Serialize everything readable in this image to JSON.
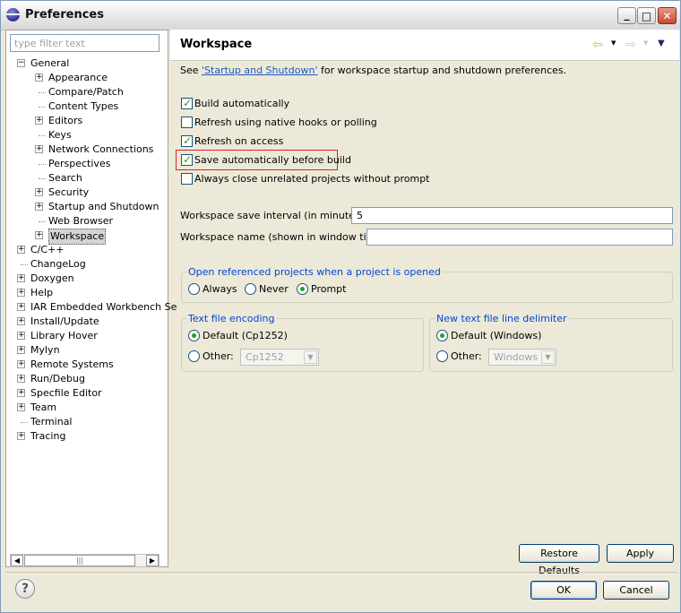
{
  "window": {
    "title": "Preferences"
  },
  "sidebar": {
    "filter_placeholder": "type filter text",
    "tree": [
      {
        "label": "General",
        "level": 0,
        "expander": "minus"
      },
      {
        "label": "Appearance",
        "level": 1,
        "expander": "plus"
      },
      {
        "label": "Compare/Patch",
        "level": 1,
        "expander": "none"
      },
      {
        "label": "Content Types",
        "level": 1,
        "expander": "none"
      },
      {
        "label": "Editors",
        "level": 1,
        "expander": "plus"
      },
      {
        "label": "Keys",
        "level": 1,
        "expander": "none"
      },
      {
        "label": "Network Connections",
        "level": 1,
        "expander": "plus"
      },
      {
        "label": "Perspectives",
        "level": 1,
        "expander": "none"
      },
      {
        "label": "Search",
        "level": 1,
        "expander": "none"
      },
      {
        "label": "Security",
        "level": 1,
        "expander": "plus"
      },
      {
        "label": "Startup and Shutdown",
        "level": 1,
        "expander": "plus"
      },
      {
        "label": "Web Browser",
        "level": 1,
        "expander": "none"
      },
      {
        "label": "Workspace",
        "level": 1,
        "expander": "plus",
        "selected": true
      },
      {
        "label": "C/C++",
        "level": 0,
        "expander": "plus"
      },
      {
        "label": "ChangeLog",
        "level": 0,
        "expander": "none"
      },
      {
        "label": "Doxygen",
        "level": 0,
        "expander": "plus"
      },
      {
        "label": "Help",
        "level": 0,
        "expander": "plus"
      },
      {
        "label": "IAR Embedded Workbench Se",
        "level": 0,
        "expander": "plus"
      },
      {
        "label": "Install/Update",
        "level": 0,
        "expander": "plus"
      },
      {
        "label": "Library Hover",
        "level": 0,
        "expander": "plus"
      },
      {
        "label": "Mylyn",
        "level": 0,
        "expander": "plus"
      },
      {
        "label": "Remote Systems",
        "level": 0,
        "expander": "plus"
      },
      {
        "label": "Run/Debug",
        "level": 0,
        "expander": "plus"
      },
      {
        "label": "Specfile Editor",
        "level": 0,
        "expander": "plus"
      },
      {
        "label": "Team",
        "level": 0,
        "expander": "plus"
      },
      {
        "label": "Terminal",
        "level": 0,
        "expander": "none"
      },
      {
        "label": "Tracing",
        "level": 0,
        "expander": "plus"
      }
    ]
  },
  "page": {
    "title": "Workspace",
    "desc_prefix": "See ",
    "desc_link": "'Startup and Shutdown'",
    "desc_suffix": " for workspace startup and shutdown preferences.",
    "checkboxes": [
      {
        "label": "Build automatically",
        "checked": true
      },
      {
        "label": "Refresh using native hooks or polling",
        "checked": false
      },
      {
        "label": "Refresh on access",
        "checked": true
      },
      {
        "label": "Save automatically before build",
        "checked": true
      },
      {
        "label": "Always close unrelated projects without prompt",
        "checked": false
      }
    ],
    "save_interval_label": "Workspace save interval (in minutes):",
    "save_interval_value": "5",
    "workspace_name_label": "Workspace name (shown in window title):",
    "workspace_name_value": "",
    "open_projects_group": {
      "title": "Open referenced projects when a project is opened",
      "options": [
        "Always",
        "Never",
        "Prompt"
      ],
      "selected": "Prompt"
    },
    "encoding_group": {
      "title": "Text file encoding",
      "default_label": "Default (Cp1252)",
      "other_label": "Other:",
      "other_value": "Cp1252"
    },
    "delimiter_group": {
      "title": "New text file line delimiter",
      "default_label": "Default (Windows)",
      "other_label": "Other:",
      "other_value": "Windows"
    },
    "restore_defaults": "Restore Defaults",
    "apply": "Apply"
  },
  "footer": {
    "ok": "OK",
    "cancel": "Cancel"
  },
  "colors": {
    "link": "#1a5ac2",
    "group_title": "#0046d5",
    "highlight_border": "#e02020"
  }
}
